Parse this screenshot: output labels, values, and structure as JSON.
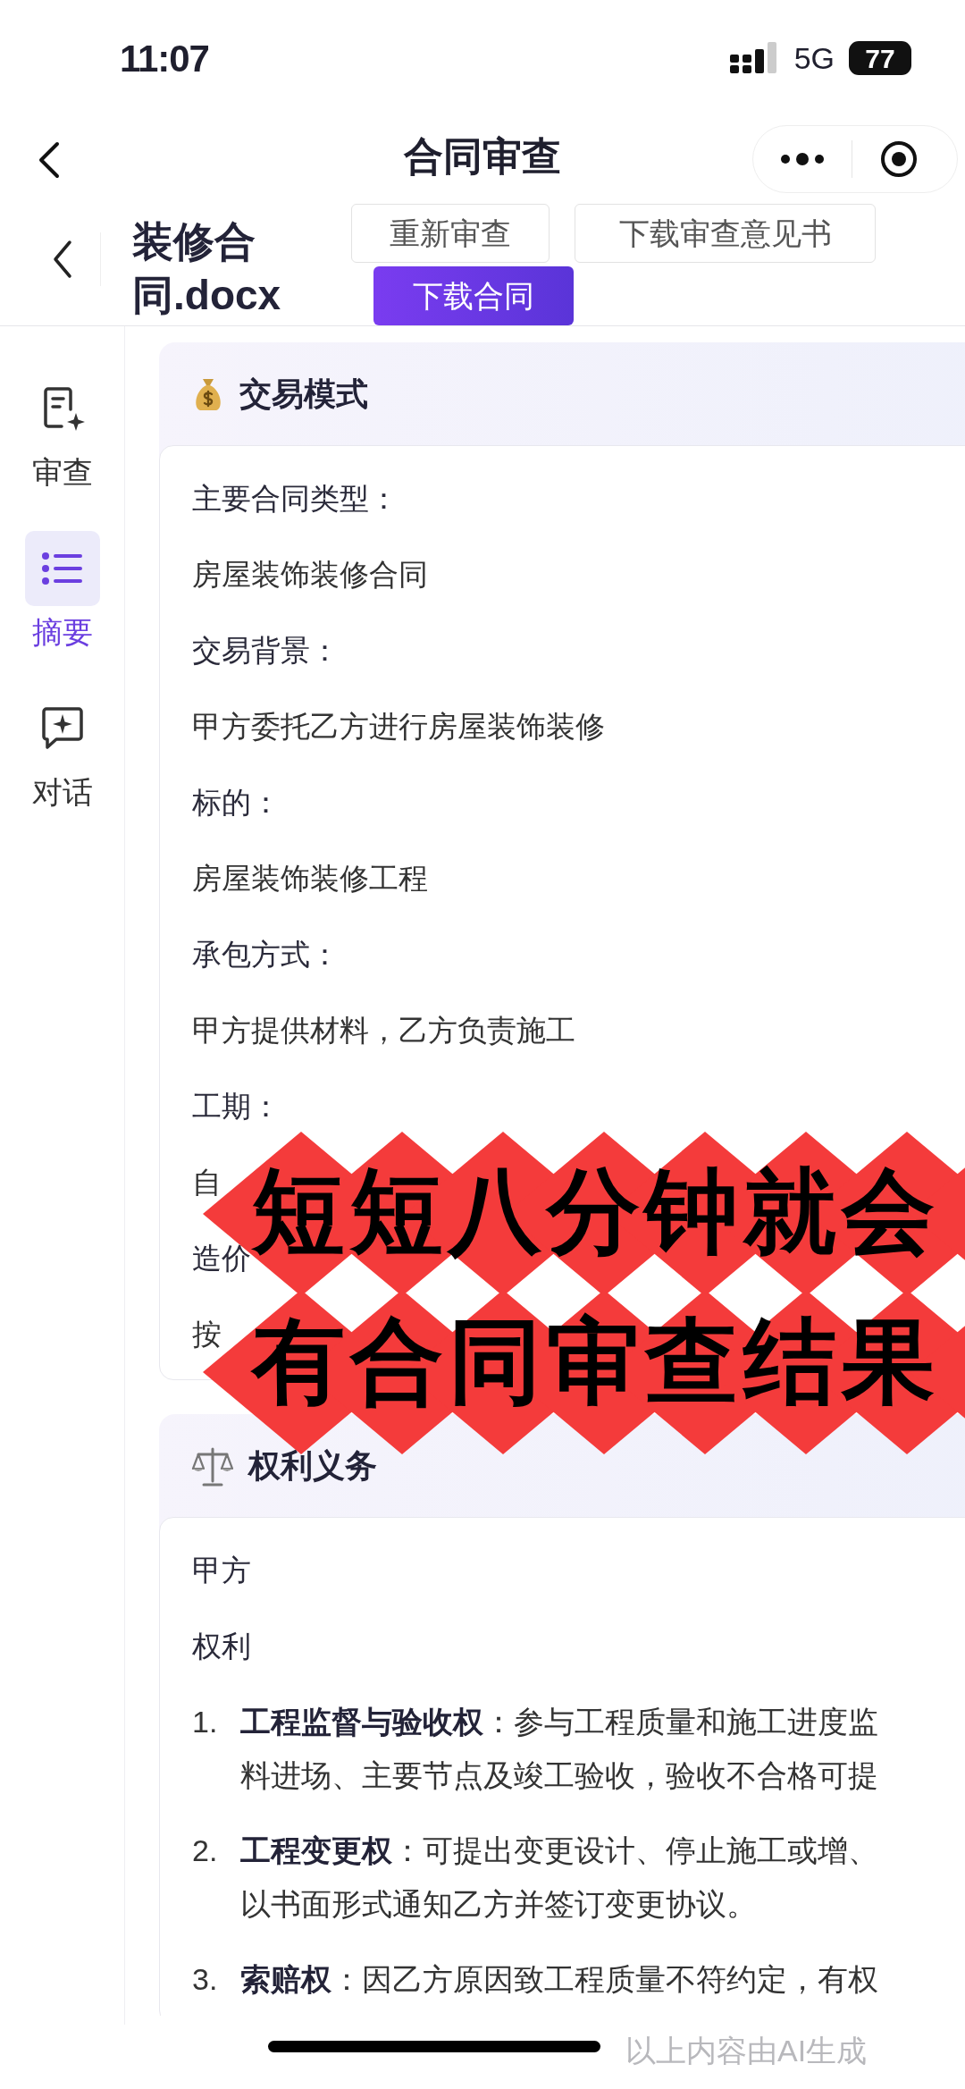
{
  "status_bar": {
    "time": "11:07",
    "network": "5G",
    "battery": "77"
  },
  "nav": {
    "title": "合同审查"
  },
  "header": {
    "file_name": "装修合同.docx",
    "buttons": [
      {
        "label": "重新审查",
        "kind": "outline"
      },
      {
        "label": "下载审查意见书",
        "kind": "outline"
      },
      {
        "label": "下载合同",
        "kind": "primary"
      }
    ]
  },
  "sidebar": {
    "items": [
      {
        "label": "审查",
        "selected": false
      },
      {
        "label": "摘要",
        "selected": true
      },
      {
        "label": "对话",
        "selected": false
      }
    ]
  },
  "sections": [
    {
      "title": "交易模式",
      "blocks": [
        {
          "kind": "label",
          "text": "主要合同类型："
        },
        {
          "kind": "value",
          "text": "房屋装饰装修合同"
        },
        {
          "kind": "label",
          "text": "交易背景："
        },
        {
          "kind": "value",
          "text": "甲方委托乙方进行房屋装饰装修"
        },
        {
          "kind": "label",
          "text": "标的："
        },
        {
          "kind": "value",
          "text": "房屋装饰装修工程"
        },
        {
          "kind": "label",
          "text": "承包方式："
        },
        {
          "kind": "value",
          "text": "甲方提供材料，乙方负责施工"
        },
        {
          "kind": "label",
          "text": "工期："
        },
        {
          "kind": "value",
          "text": "自"
        },
        {
          "kind": "label",
          "text": "造价"
        },
        {
          "kind": "value",
          "text": "按"
        }
      ]
    },
    {
      "title": "权利义务",
      "blocks": [
        {
          "kind": "label",
          "text": "甲方"
        },
        {
          "kind": "label",
          "text": "权利"
        },
        {
          "kind": "item",
          "number": "1.",
          "term": "工程监督与验收权",
          "lines": [
            "：参与工程质量和施工进度监",
            "料进场、主要节点及竣工验收，验收不合格可提"
          ]
        },
        {
          "kind": "item",
          "number": "2.",
          "term": "工程变更权",
          "lines": [
            "：可提出变更设计、停止施工或增、",
            "以书面形式通知乙方并签订变更协议。"
          ]
        },
        {
          "kind": "item",
          "number": "3.",
          "term": "索赔权",
          "lines": [
            "：因乙方原因致工程质量不符约定，有权"
          ]
        }
      ]
    }
  ],
  "overlay": {
    "lines": [
      "短短八分钟就会",
      "有合同审查结果"
    ]
  },
  "footer": {
    "note": "以上内容由AI生成"
  }
}
